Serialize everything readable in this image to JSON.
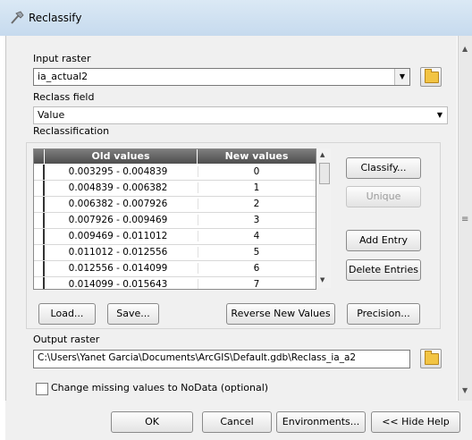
{
  "window": {
    "title": "Reclassify"
  },
  "input_raster": {
    "label": "Input raster",
    "value": "ia_actual2"
  },
  "reclass_field": {
    "label": "Reclass field",
    "value": "Value"
  },
  "reclassification": {
    "label": "Reclassification",
    "columns": [
      "Old values",
      "New values"
    ],
    "rows": [
      {
        "old": "0.003295 - 0.004839",
        "new": "0"
      },
      {
        "old": "0.004839 - 0.006382",
        "new": "1"
      },
      {
        "old": "0.006382 - 0.007926",
        "new": "2"
      },
      {
        "old": "0.007926 - 0.009469",
        "new": "3"
      },
      {
        "old": "0.009469 - 0.011012",
        "new": "4"
      },
      {
        "old": "0.011012 - 0.012556",
        "new": "5"
      },
      {
        "old": "0.012556 - 0.014099",
        "new": "6"
      },
      {
        "old": "0.014099 - 0.015643",
        "new": "7"
      }
    ],
    "buttons": {
      "classify": "Classify...",
      "unique": "Unique",
      "add_entry": "Add Entry",
      "delete_entries": "Delete Entries",
      "load": "Load...",
      "save": "Save...",
      "reverse": "Reverse New Values",
      "precision": "Precision..."
    }
  },
  "output_raster": {
    "label": "Output raster",
    "value": "C:\\Users\\Yanet Garcia\\Documents\\ArcGIS\\Default.gdb\\Reclass_ia_a2"
  },
  "nodata_checkbox": {
    "label": "Change missing values to NoData (optional)",
    "checked": false
  },
  "footer": {
    "ok": "OK",
    "cancel": "Cancel",
    "environments": "Environments...",
    "hide_help": "<< Hide Help"
  },
  "icons": {
    "title": "hammer-icon",
    "browse": "open-folder-icon"
  }
}
